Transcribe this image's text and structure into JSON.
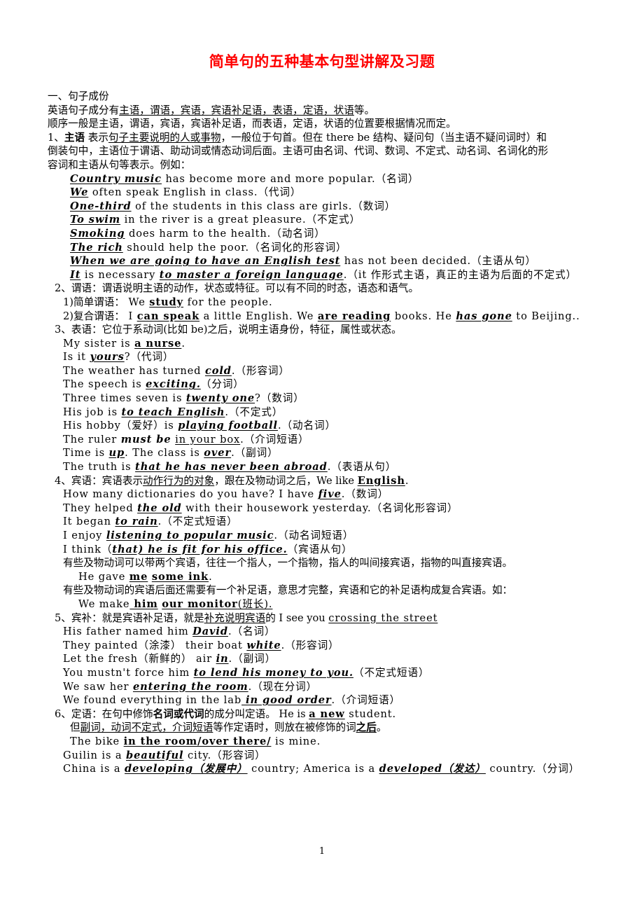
{
  "document": {
    "title": "简单句的五种基本句型讲解及习题",
    "title_color": "#ff0000",
    "page_number": "1"
  },
  "sections": {
    "heading_1": "一、句子成份",
    "line_components_a": "英语句子成分有",
    "line_components_a_underlined": "主语，谓语，宾语，宾语补足语，表语，定语，状语",
    "line_components_a_tail": "等。",
    "line_components_b": "顺序一般是主语，谓语，宾语，宾语补足语，而表语，定语，状语的位置要根据情况而定。"
  },
  "subject": {
    "marker": "1、",
    "label": "主语",
    "desc_pre": " 表示",
    "desc_underlined": "句子主要说明的人或事物",
    "desc_post": "，一般位于句首。但在 there be 结构、疑问句（当主语不疑问词时）和",
    "desc_line2": "倒装句中，主语位于谓语、助动词或情态动词后面。主语可由名词、代词、数词、不定式、动名词、名词化的形",
    "desc_line3": "容词和主语从句等表示。例如：",
    "examples": [
      {
        "em": "Country music",
        "rest": " has become more and more popular.",
        "note": "（名词）"
      },
      {
        "em": "We",
        "rest": " often speak English in class.",
        "note": "（代词）"
      },
      {
        "em": "One-third",
        "rest": " of the students in this class are girls.",
        "note": "（数词）"
      },
      {
        "em": "To swim",
        "rest": " in the river is a great pleasure.",
        "note": "（不定式）"
      },
      {
        "em": "Smoking",
        "rest": " does harm to the health.",
        "note": "（动名词）"
      },
      {
        "em": "The rich",
        "rest": " should help the poor.",
        "note": "（名词化的形容词）"
      },
      {
        "em": "When we are going to have an English test",
        "rest": " has not been decided.",
        "note": "（主语从句）"
      }
    ],
    "example_it_a": "It",
    "example_it_b": " is necessary ",
    "example_it_c": "to master a foreign language",
    "example_it_d": ".（it 作形式主语，真正的主语为后面的不定式）"
  },
  "predicate": {
    "heading": "2、谓语：谓语说明主语的动作，状态或特征。可以有不同的时态，语态和语气。",
    "simple_label": "1)简单谓语：",
    "simple_pre": "  We ",
    "simple_em": "study",
    "simple_post": " for the people.",
    "compound_label": "2)复合谓语：",
    "compound_seg1_pre": "   I ",
    "compound_seg1_em": "can speak",
    "compound_seg1_post": " a little English.  We ",
    "compound_seg2_em": "are reading",
    "compound_seg2_post": " books.  He ",
    "compound_seg3_em": "has gone",
    "compound_seg3_post": " to  Beijing.."
  },
  "predicative": {
    "heading": "3、表语：它位于系动词(比如 be)之后，说明主语身份，特征，属性或状态。",
    "examples": [
      {
        "pre": "My sister is ",
        "em": "a nurse",
        "post": ".",
        "note": "",
        "style": "bu"
      },
      {
        "pre": "Is it ",
        "em": "yours",
        "post": "?",
        "note": "（代词）",
        "style": "biu"
      },
      {
        "pre": "The weather has turned ",
        "em": "cold",
        "post": ".",
        "note": "（形容词）",
        "style": "biu"
      },
      {
        "pre": "The speech is ",
        "em": "exciting.",
        "post": "",
        "note": "（分词）",
        "style": "biu"
      },
      {
        "pre": "Three times seven is ",
        "em": "twenty one",
        "post": "?",
        "note": "（数词）",
        "style": "biu"
      },
      {
        "pre": "His job is ",
        "em": "to teach English",
        "post": ".",
        "note": "（不定式）",
        "style": "biu"
      },
      {
        "pre": "His hobby（爱好）is ",
        "em": "playing football",
        "post": ".",
        "note": "（动名词）",
        "style": "biu"
      },
      {
        "pre": "The ruler ",
        "em": "must be",
        "post": "",
        "note": "",
        "style": "bi"
      }
    ],
    "ruler_extra_pre": " ",
    "ruler_extra_em": "in your box",
    "ruler_extra_post": ".（介词短语）",
    "time_line_a": "Time is ",
    "time_line_a_em": "up",
    "time_line_b": ". The class is ",
    "time_line_b_em": "over",
    "time_line_c": ".（副词）",
    "truth_line_pre": "The truth is ",
    "truth_line_em": "that he has never been abroad",
    "truth_line_post": ".（表语从句）"
  },
  "object": {
    "heading_pre": "4、宾语：宾语表示",
    "heading_u": "动作行为的对象",
    "heading_mid": "，跟在及物动词之后，We like ",
    "heading_em": "English",
    "heading_post": ".",
    "examples": [
      {
        "pre": "How many dictionaries do you have? I have ",
        "em": "five",
        "post": ".",
        "note": "（数词）",
        "style": "biu"
      },
      {
        "pre": "They helped ",
        "em": "the old",
        "post": " with their housework yesterday.",
        "note": "（名词化形容词）",
        "style": "biu"
      },
      {
        "pre": "It began ",
        "em": "to rain",
        "post": ".",
        "note": "（不定式短语）",
        "style": "biu"
      },
      {
        "pre": "I enjoy ",
        "em": "listening to popular music",
        "post": ".",
        "note": "（动名词短语）",
        "style": "biu"
      },
      {
        "pre": "I think（",
        "em": "that) he is fit for his office.",
        "post": "",
        "note": "（宾语从句）",
        "style": "biu"
      }
    ],
    "note_double": "有些及物动词可以带两个宾语，往往一个指人，一个指物，指人的叫间接宾语，指物的叫直接宾语。",
    "example_gave_pre": "He gave ",
    "example_gave_em1": "me",
    "example_gave_mid": " ",
    "example_gave_em2": "some ink",
    "example_gave_post": ".",
    "note_complement": "有些及物动词的宾语后面还需要有一个补足语，意思才完整，宾语和它的补足语构成复合宾语。如：",
    "example_make_pre": "We make",
    "example_make_em1": " him",
    "example_make_mid": " ",
    "example_make_em2": "our monitor",
    "example_make_post": "(班长)."
  },
  "object_complement": {
    "heading_pre": "5、宾补：就是宾语补足语，就是",
    "heading_u1": "补充说明宾语",
    "heading_mid": "的 I see you ",
    "heading_u2": "crossing the street",
    "examples": [
      {
        "pre": "His father named him ",
        "em": "David",
        "post": ".",
        "note": "（名词）",
        "style": "biu"
      },
      {
        "pre": "They painted（涂漆） their boat ",
        "em": "white",
        "post": ".",
        "note": "（形容词）",
        "style": "biu"
      },
      {
        "pre": "Let the fresh（新鲜的） air ",
        "em": "in",
        "post": ".",
        "note": "（副词）",
        "style": "biu"
      },
      {
        "pre": "You mustn't force him ",
        "em": "to lend his money to you.",
        "post": "",
        "note": "（不定式短语）",
        "style": "biu"
      },
      {
        "pre": "We saw her ",
        "em": "entering the room",
        "post": ".",
        "note": "（现在分词）",
        "style": "biu"
      },
      {
        "pre": "We found everything in the lab",
        "em": " in good order",
        "post": ".",
        "note": "（介词短语）",
        "style": "biu"
      }
    ]
  },
  "attributive": {
    "heading_pre": "6、定语：在句中修饰",
    "heading_b": "名词或代词",
    "heading_mid": "的成分叫定语。   He is ",
    "heading_em": "a new",
    "heading_post": " student.",
    "note_pre": "但",
    "note_u": "副词，动词不定式，介词短语",
    "note_mid": "等作定语时，则放在被修饰的词",
    "note_bu": "之后",
    "note_post": "。",
    "examples": [
      {
        "pre": "The bike ",
        "em": "in the room/over there/",
        "post": " is mine.",
        "note": "",
        "style": "bu"
      },
      {
        "pre": "Guilin is a ",
        "em": "beautiful",
        "post": " city.",
        "note": "（形容词）",
        "style": "biu"
      }
    ],
    "china_pre": "China is a ",
    "china_em1": "developing（发展中）",
    "china_mid": " country; America is a ",
    "china_em2": "developed（发达）",
    "china_post": " country.",
    "china_note": "（分词）"
  }
}
